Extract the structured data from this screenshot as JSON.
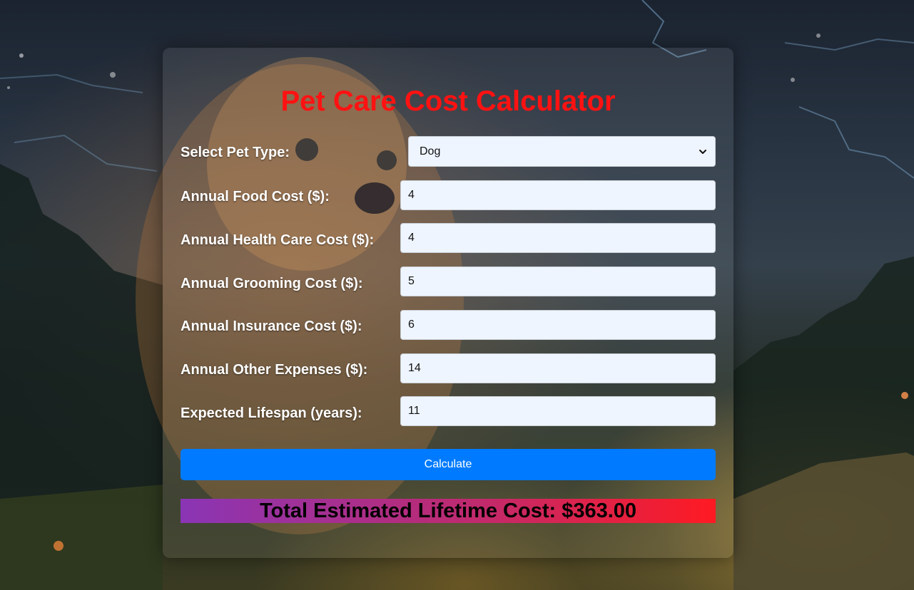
{
  "page": {
    "title": "Pet Care Cost Calculator"
  },
  "form": {
    "pet_type": {
      "label": "Select Pet Type:",
      "selected": "Dog"
    },
    "fields": [
      {
        "label": "Annual Food Cost ($):",
        "value": "4"
      },
      {
        "label": "Annual Health Care Cost ($):",
        "value": "4"
      },
      {
        "label": "Annual Grooming Cost ($):",
        "value": "5"
      },
      {
        "label": "Annual Insurance Cost ($):",
        "value": "6"
      },
      {
        "label": "Annual Other Expenses ($):",
        "value": "14"
      },
      {
        "label": "Expected Lifespan (years):",
        "value": "11"
      }
    ],
    "calculate_label": "Calculate"
  },
  "result": {
    "text": "Total Estimated Lifetime Cost: $363.00"
  },
  "colors": {
    "title": "#ff1212",
    "button": "#007bff",
    "input_bg": "#eef5ff",
    "result_gradient_start": "#8a35b5",
    "result_gradient_end": "#ff1a22"
  },
  "icons": {
    "select_arrow": "chevron-down-icon",
    "background": "dog-night-scene-image"
  }
}
